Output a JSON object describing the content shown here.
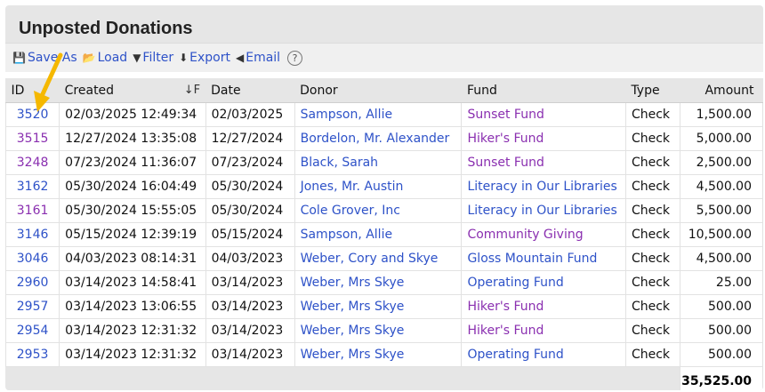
{
  "title": "Unposted Donations",
  "toolbar": {
    "save_as": "Save As",
    "load": "Load",
    "filter": "Filter",
    "export": "Export",
    "email": "Email",
    "help": "?"
  },
  "columns": {
    "id": "ID",
    "created": "Created",
    "sort_glyph": "↓F",
    "date": "Date",
    "donor": "Donor",
    "fund": "Fund",
    "type": "Type",
    "amount": "Amount"
  },
  "rows": [
    {
      "id": "3520",
      "created": "02/03/2025 12:49:34",
      "date": "02/03/2025",
      "donor": "Sampson, Allie",
      "fund": "Sunset Fund",
      "type": "Check",
      "amount": "1,500.00"
    },
    {
      "id": "3515",
      "created": "12/27/2024 13:35:08",
      "date": "12/27/2024",
      "donor": "Bordelon, Mr. Alexander",
      "fund": "Hiker's Fund",
      "type": "Check",
      "amount": "5,000.00"
    },
    {
      "id": "3248",
      "created": "07/23/2024 11:36:07",
      "date": "07/23/2024",
      "donor": "Black, Sarah",
      "fund": "Sunset Fund",
      "type": "Check",
      "amount": "2,500.00"
    },
    {
      "id": "3162",
      "created": "05/30/2024 16:04:49",
      "date": "05/30/2024",
      "donor": "Jones, Mr. Austin",
      "fund": "Literacy in Our Libraries",
      "type": "Check",
      "amount": "4,500.00"
    },
    {
      "id": "3161",
      "created": "05/30/2024 15:55:05",
      "date": "05/30/2024",
      "donor": "Cole Grover, Inc",
      "fund": "Literacy in Our Libraries",
      "type": "Check",
      "amount": "5,500.00"
    },
    {
      "id": "3146",
      "created": "05/15/2024 12:39:19",
      "date": "05/15/2024",
      "donor": "Sampson, Allie",
      "fund": "Community Giving",
      "type": "Check",
      "amount": "10,500.00"
    },
    {
      "id": "3046",
      "created": "04/03/2023 08:14:31",
      "date": "04/03/2023",
      "donor": "Weber, Cory and Skye",
      "fund": "Gloss Mountain Fund",
      "type": "Check",
      "amount": "4,500.00"
    },
    {
      "id": "2960",
      "created": "03/14/2023 14:58:41",
      "date": "03/14/2023",
      "donor": "Weber, Mrs Skye",
      "fund": "Operating Fund",
      "type": "Check",
      "amount": "25.00"
    },
    {
      "id": "2957",
      "created": "03/14/2023 13:06:55",
      "date": "03/14/2023",
      "donor": "Weber, Mrs Skye",
      "fund": "Hiker's Fund",
      "type": "Check",
      "amount": "500.00"
    },
    {
      "id": "2954",
      "created": "03/14/2023 12:31:32",
      "date": "03/14/2023",
      "donor": "Weber, Mrs Skye",
      "fund": "Hiker's Fund",
      "type": "Check",
      "amount": "500.00"
    },
    {
      "id": "2953",
      "created": "03/14/2023 12:31:32",
      "date": "03/14/2023",
      "donor": "Weber, Mrs Skye",
      "fund": "Operating Fund",
      "type": "Check",
      "amount": "500.00"
    }
  ],
  "total": "35,525.00",
  "colors": {
    "link": "#2e52c8",
    "visited": "#8a2fb0",
    "arrow": "#f5b800"
  }
}
